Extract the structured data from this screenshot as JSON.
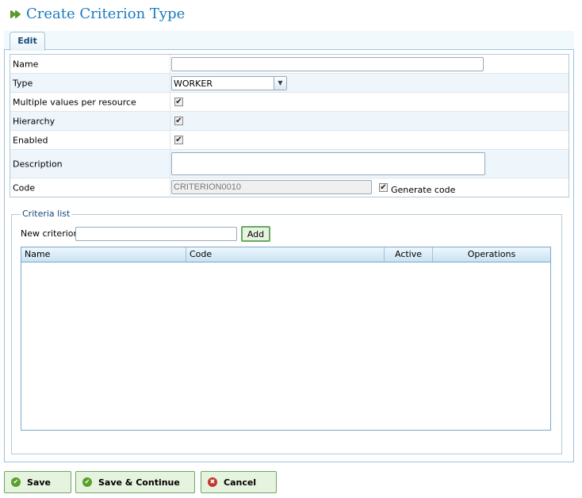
{
  "title": "Create Criterion Type",
  "tab": "Edit",
  "form": {
    "name_label": "Name",
    "name_value": "",
    "type_label": "Type",
    "type_value": "WORKER",
    "multiple_label": "Multiple values per resource",
    "multiple_checked": true,
    "hierarchy_label": "Hierarchy",
    "hierarchy_checked": true,
    "enabled_label": "Enabled",
    "enabled_checked": true,
    "description_label": "Description",
    "description_value": "",
    "code_label": "Code",
    "code_value": "CRITERION0010",
    "generate_code_label": "Generate code",
    "generate_code_checked": true
  },
  "criteria": {
    "legend": "Criteria list",
    "new_label": "New criterion",
    "new_value": "",
    "add_label": "Add",
    "columns": [
      "Name",
      "Code",
      "Active",
      "Operations"
    ],
    "rows": []
  },
  "buttons": {
    "save": "Save",
    "save_continue": "Save & Continue",
    "cancel": "Cancel"
  },
  "colors": {
    "accent": "#1a7ac0",
    "button_bg": "#e6f3de",
    "ok_icon": "#5aa02c",
    "cancel_icon": "#c0392b"
  }
}
